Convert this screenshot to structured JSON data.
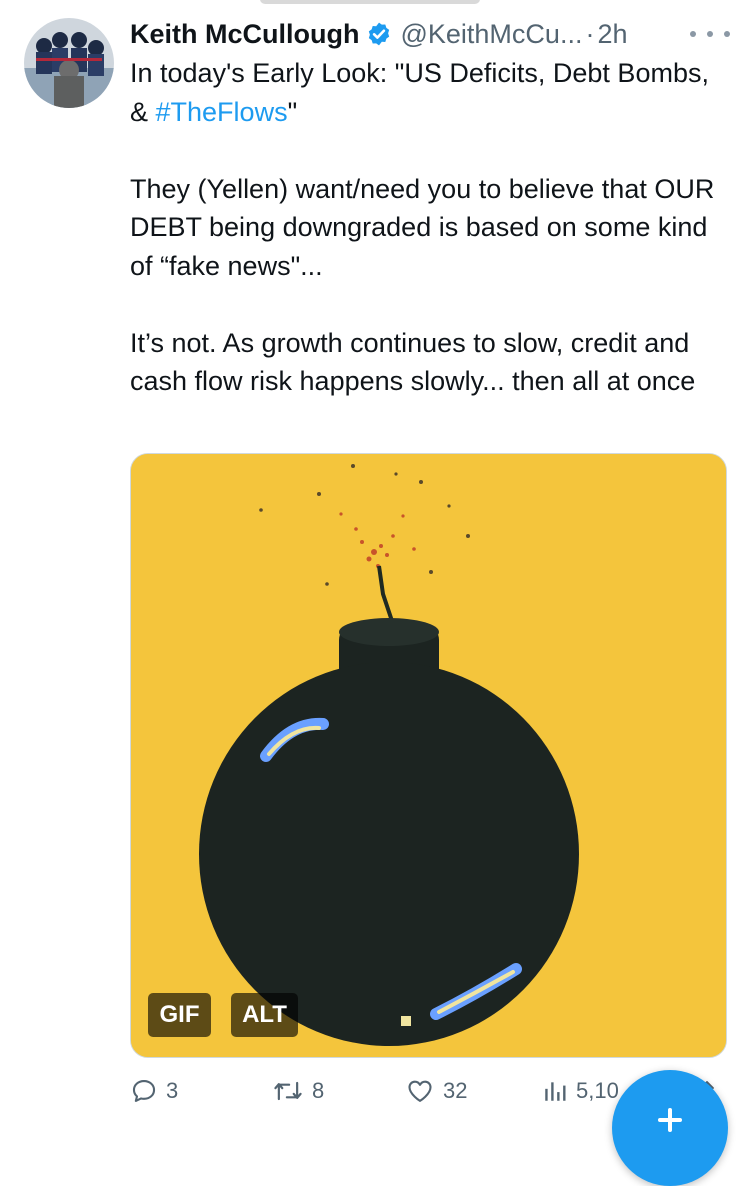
{
  "tweet": {
    "author_name": "Keith McCullough",
    "handle": "@KeithMcCu...",
    "separator": "·",
    "time": "2h",
    "text": {
      "p1_before": "In today's Early Look: \"US Deficits, Debt Bombs, & ",
      "p1_hashtag": "#TheFlows",
      "p1_after": "\"",
      "p2": "They (Yellen) want/need you to believe that OUR DEBT being downgraded is based on some kind of “fake news\"...",
      "p3": "It’s not. As growth continues to slow, credit and cash flow risk happens slowly... then all at once"
    },
    "media": {
      "gif_label": "GIF",
      "alt_label": "ALT",
      "background_color": "#f4c53c"
    }
  },
  "actions": {
    "replies": "3",
    "retweets": "8",
    "likes": "32",
    "views": "5,10"
  },
  "colors": {
    "accent": "#1d9bf0",
    "text": "#0f1419",
    "muted": "#536471"
  },
  "icons": {
    "verified": "verified-badge-icon",
    "more": "more-dots-icon",
    "reply": "reply-icon",
    "retweet": "retweet-icon",
    "like": "heart-icon",
    "views": "views-icon",
    "share": "share-icon",
    "compose": "plus-icon"
  }
}
